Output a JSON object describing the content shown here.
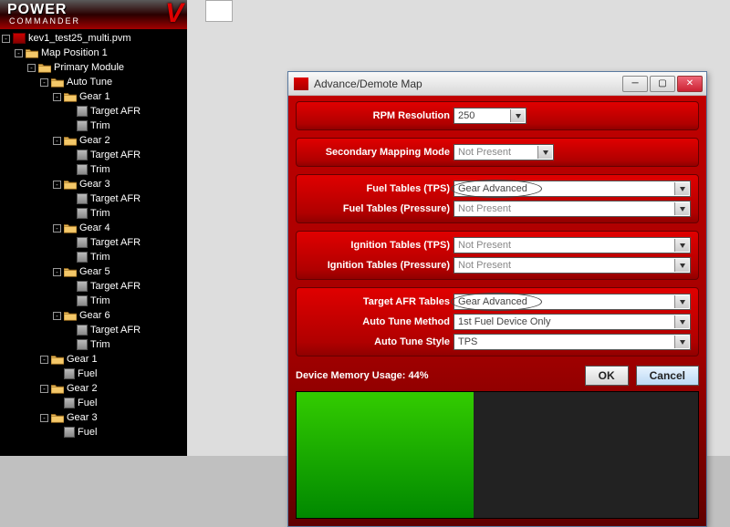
{
  "brand": {
    "main": "POWER",
    "sub": "COMMANDER",
    "v": "V"
  },
  "tree": [
    {
      "depth": 0,
      "toggle": "-",
      "icon": "pvm",
      "label": "kev1_test25_multi.pvm"
    },
    {
      "depth": 1,
      "toggle": "-",
      "icon": "folder-open",
      "label": "Map Position 1"
    },
    {
      "depth": 2,
      "toggle": "-",
      "icon": "folder-open",
      "label": "Primary Module"
    },
    {
      "depth": 3,
      "toggle": "-",
      "icon": "folder-open",
      "label": "Auto Tune"
    },
    {
      "depth": 4,
      "toggle": "-",
      "icon": "folder-open",
      "label": "Gear 1"
    },
    {
      "depth": 5,
      "toggle": "",
      "icon": "leaf",
      "label": "Target AFR"
    },
    {
      "depth": 5,
      "toggle": "",
      "icon": "leaf",
      "label": "Trim"
    },
    {
      "depth": 4,
      "toggle": "-",
      "icon": "folder-open",
      "label": "Gear 2"
    },
    {
      "depth": 5,
      "toggle": "",
      "icon": "leaf",
      "label": "Target AFR"
    },
    {
      "depth": 5,
      "toggle": "",
      "icon": "leaf",
      "label": "Trim"
    },
    {
      "depth": 4,
      "toggle": "-",
      "icon": "folder-open",
      "label": "Gear 3"
    },
    {
      "depth": 5,
      "toggle": "",
      "icon": "leaf",
      "label": "Target AFR"
    },
    {
      "depth": 5,
      "toggle": "",
      "icon": "leaf",
      "label": "Trim"
    },
    {
      "depth": 4,
      "toggle": "-",
      "icon": "folder-open",
      "label": "Gear 4"
    },
    {
      "depth": 5,
      "toggle": "",
      "icon": "leaf",
      "label": "Target AFR"
    },
    {
      "depth": 5,
      "toggle": "",
      "icon": "leaf",
      "label": "Trim"
    },
    {
      "depth": 4,
      "toggle": "-",
      "icon": "folder-open",
      "label": "Gear 5"
    },
    {
      "depth": 5,
      "toggle": "",
      "icon": "leaf",
      "label": "Target AFR"
    },
    {
      "depth": 5,
      "toggle": "",
      "icon": "leaf",
      "label": "Trim"
    },
    {
      "depth": 4,
      "toggle": "-",
      "icon": "folder-open",
      "label": "Gear 6"
    },
    {
      "depth": 5,
      "toggle": "",
      "icon": "leaf",
      "label": "Target AFR"
    },
    {
      "depth": 5,
      "toggle": "",
      "icon": "leaf",
      "label": "Trim"
    },
    {
      "depth": 3,
      "toggle": "-",
      "icon": "folder-open",
      "label": "Gear 1"
    },
    {
      "depth": 4,
      "toggle": "",
      "icon": "leaf",
      "label": "Fuel"
    },
    {
      "depth": 3,
      "toggle": "-",
      "icon": "folder-open",
      "label": "Gear 2"
    },
    {
      "depth": 4,
      "toggle": "",
      "icon": "leaf",
      "label": "Fuel"
    },
    {
      "depth": 3,
      "toggle": "-",
      "icon": "folder-open",
      "label": "Gear 3"
    },
    {
      "depth": 4,
      "toggle": "",
      "icon": "leaf",
      "label": "Fuel"
    }
  ],
  "dialog": {
    "title": "Advance/Demote Map",
    "panels": {
      "rpm": {
        "label": "RPM Resolution",
        "value": "250"
      },
      "secondary": {
        "label": "Secondary Mapping Mode",
        "value": "Not Present",
        "disabled": true
      },
      "fuel_tps": {
        "label": "Fuel Tables (TPS)",
        "value": "Gear Advanced",
        "circled": true
      },
      "fuel_pressure": {
        "label": "Fuel Tables (Pressure)",
        "value": "Not Present",
        "disabled": true
      },
      "ign_tps": {
        "label": "Ignition Tables (TPS)",
        "value": "Not Present",
        "disabled": true
      },
      "ign_pressure": {
        "label": "Ignition Tables (Pressure)",
        "value": "Not Present",
        "disabled": true
      },
      "target_afr": {
        "label": "Target AFR Tables",
        "value": "Gear Advanced",
        "circled": true
      },
      "at_method": {
        "label": "Auto Tune Method",
        "value": "1st Fuel Device Only"
      },
      "at_style": {
        "label": "Auto Tune Style",
        "value": "TPS"
      }
    },
    "memory": {
      "label": "Device Memory Usage:",
      "percent": 44,
      "text": "44%"
    },
    "buttons": {
      "ok": "OK",
      "cancel": "Cancel"
    }
  }
}
